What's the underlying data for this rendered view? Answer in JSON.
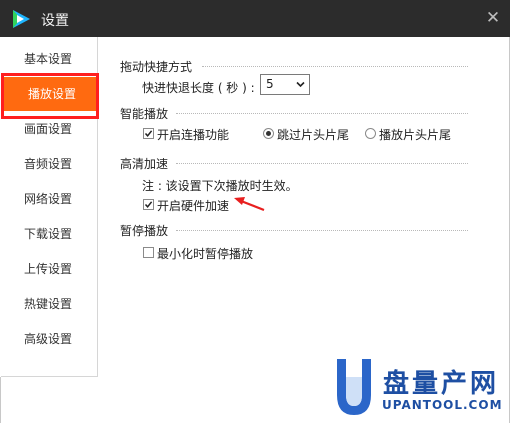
{
  "window": {
    "title": "设置"
  },
  "sidebar": {
    "items": [
      {
        "label": "基本设置"
      },
      {
        "label": "播放设置"
      },
      {
        "label": "画面设置"
      },
      {
        "label": "音频设置"
      },
      {
        "label": "网络设置"
      },
      {
        "label": "下载设置"
      },
      {
        "label": "上传设置"
      },
      {
        "label": "热键设置"
      },
      {
        "label": "高级设置"
      }
    ],
    "active_index": 1
  },
  "seek": {
    "section_title": "拖动快捷方式",
    "label": "快进快退长度 ( 秒 ) :",
    "value": "5"
  },
  "smart_play": {
    "section_title": "智能播放",
    "continuous_label": "开启连播功能",
    "continuous_checked": true,
    "skip_label": "跳过片头片尾",
    "skip_selected": true,
    "play_label": "播放片头片尾",
    "play_selected": false
  },
  "hd": {
    "section_title": "高清加速",
    "note": "注 : 该设置下次播放时生效。",
    "hw_label": "开启硬件加速",
    "hw_checked": true
  },
  "pause": {
    "section_title": "暂停播放",
    "minimize_label": "最小化时暂停播放",
    "minimize_checked": false
  },
  "watermark": {
    "name": "盘量产网",
    "url": "UPANTOOL.COM"
  },
  "colors": {
    "active_tab": "#ff6a10",
    "highlight": "#ff1f1f",
    "titlebar": "#2c2c2c",
    "watermark": "#1e4fa3"
  }
}
